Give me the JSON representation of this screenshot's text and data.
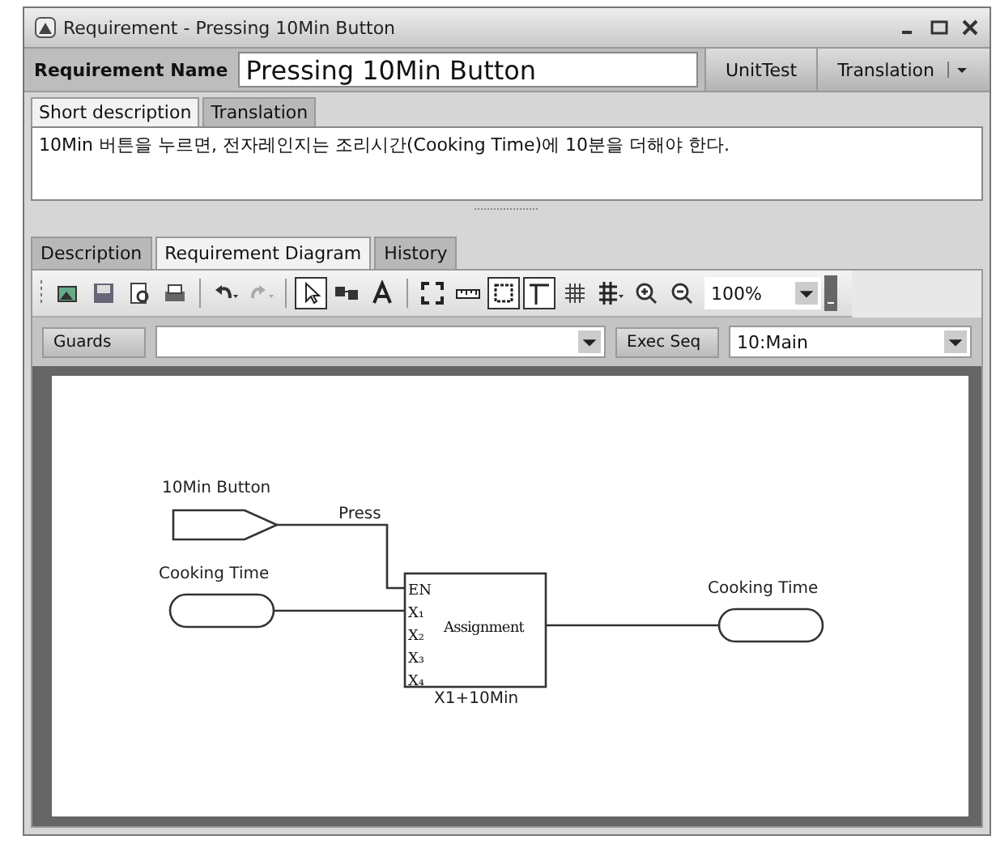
{
  "window": {
    "title": "Requirement - Pressing 10Min Button"
  },
  "requirement_name": {
    "label": "Requirement Name",
    "value": "Pressing 10Min Button"
  },
  "header_buttons": [
    {
      "label": "UnitTest",
      "kind": "button"
    },
    {
      "label": "Translation",
      "kind": "split_button"
    }
  ],
  "description_tabs": [
    {
      "label": "Short description",
      "selected": true
    },
    {
      "label": "Translation",
      "selected": false
    }
  ],
  "short_description": "10Min 버튼을 누르면, 전자레인지는 조리시간(Cooking Time)에 10분을 더해야 한다.",
  "main_tabs": [
    {
      "label": "Description",
      "selected": false
    },
    {
      "label": "Requirement Diagram",
      "selected": true
    },
    {
      "label": "History",
      "selected": false
    }
  ],
  "toolbar": {
    "tools": [
      {
        "kind": "image",
        "selected": false
      },
      {
        "kind": "save",
        "selected": false
      },
      {
        "kind": "preview",
        "selected": false
      },
      {
        "kind": "print",
        "selected": false
      },
      {
        "kind": "separator"
      },
      {
        "kind": "undo",
        "selected": false
      },
      {
        "kind": "redo",
        "selected": false
      },
      {
        "kind": "separator"
      },
      {
        "kind": "pointer",
        "selected": true
      },
      {
        "kind": "link",
        "selected": false
      },
      {
        "kind": "text",
        "selected": false
      },
      {
        "kind": "separator"
      },
      {
        "kind": "fit",
        "selected": false
      },
      {
        "kind": "ruler",
        "selected": false
      },
      {
        "kind": "frame",
        "selected": true
      },
      {
        "kind": "guide",
        "selected": true
      },
      {
        "kind": "grid",
        "selected": false
      },
      {
        "kind": "grid_large",
        "selected": false
      },
      {
        "kind": "zoom_in",
        "selected": false
      },
      {
        "kind": "zoom_out",
        "selected": false
      }
    ],
    "zoom": "100%"
  },
  "guards": {
    "label": "Guards"
  },
  "exec_seq": {
    "label": "Exec Seq",
    "value": "10:Main"
  },
  "diagram": {
    "nodes": [
      {
        "kind": "event_input",
        "label": "10Min Button",
        "signal": "Press"
      },
      {
        "kind": "data_input",
        "label": "Cooking Time"
      },
      {
        "kind": "data_output",
        "label": "Cooking Time"
      }
    ],
    "block": {
      "name": "Assignment",
      "ports": [
        "EN",
        "X₁",
        "X₂",
        "X₃",
        "X₄"
      ],
      "expression": "X1+10Min"
    }
  }
}
